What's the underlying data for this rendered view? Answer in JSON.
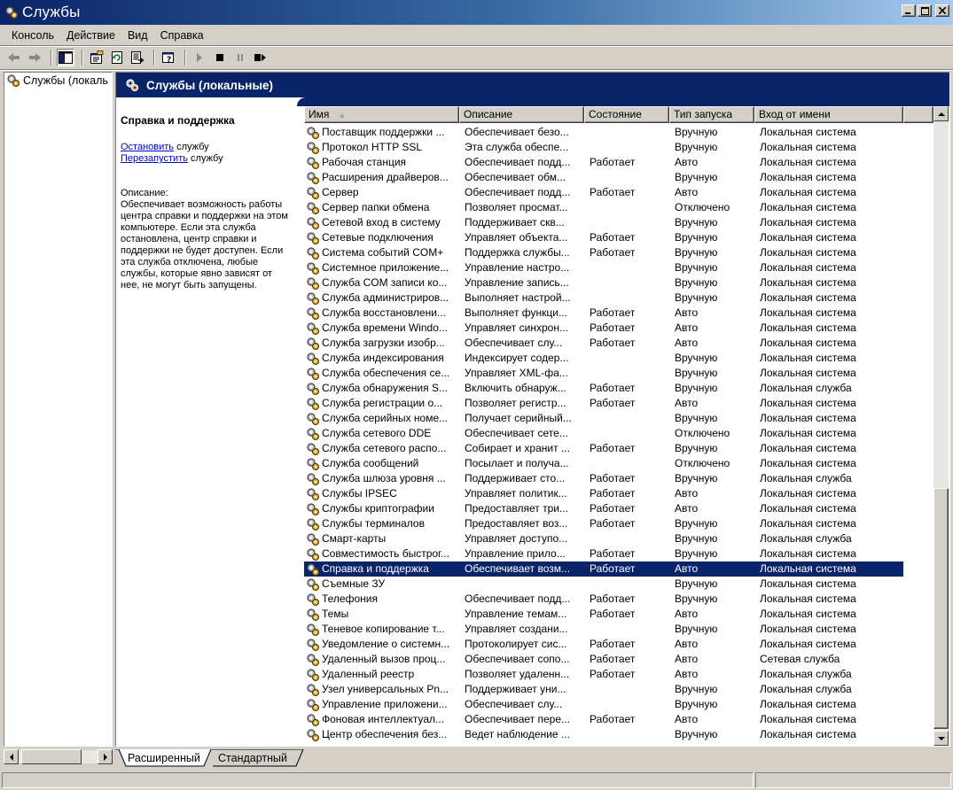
{
  "window": {
    "title": "Службы",
    "buttons": [
      "_",
      "□",
      "×"
    ]
  },
  "menu": [
    "Консоль",
    "Действие",
    "Вид",
    "Справка"
  ],
  "toolbar": {
    "icons": [
      "back-arrow-icon",
      "forward-arrow-icon",
      "show-hide-tree-icon",
      "properties-icon",
      "refresh-icon",
      "export-list-icon",
      "help-icon",
      "start-service-icon",
      "stop-service-icon",
      "pause-service-icon",
      "restart-service-icon"
    ]
  },
  "tree": {
    "items": [
      {
        "label": "Службы (локаль"
      }
    ]
  },
  "pane": {
    "title": "Службы (локальные)",
    "extended": {
      "heading": "Справка и поддержка",
      "actions": [
        {
          "link": "Остановить",
          "rest": " службу"
        },
        {
          "link": "Перезапустить",
          "rest": " службу"
        }
      ],
      "description_label": "Описание:",
      "description": "Обеспечивает возможность работы центра справки и поддержки на этом компьютере. Если эта служба остановлена, центр справки и поддержки не будет доступен. Если эта служба отключена, любые службы, которые явно зависят от нее, не могут быть запущены."
    }
  },
  "list": {
    "columns": [
      "Имя",
      "Описание",
      "Состояние",
      "Тип запуска",
      "Вход от имени"
    ],
    "sort_indicator": "▲",
    "selected_index": 29,
    "rows": [
      [
        "Поставщик поддержки ...",
        "Обеспечивает безо...",
        "",
        "Вручную",
        "Локальная система"
      ],
      [
        "Протокол HTTP SSL",
        "Эта служба обеспе...",
        "",
        "Вручную",
        "Локальная система"
      ],
      [
        "Рабочая станция",
        "Обеспечивает подд...",
        "Работает",
        "Авто",
        "Локальная система"
      ],
      [
        "Расширения драйверов...",
        "Обеспечивает обм...",
        "",
        "Вручную",
        "Локальная система"
      ],
      [
        "Сервер",
        "Обеспечивает подд...",
        "Работает",
        "Авто",
        "Локальная система"
      ],
      [
        "Сервер папки обмена",
        "Позволяет просмат...",
        "",
        "Отключено",
        "Локальная система"
      ],
      [
        "Сетевой вход в систему",
        "Поддерживает скв...",
        "",
        "Вручную",
        "Локальная система"
      ],
      [
        "Сетевые подключения",
        "Управляет объекта...",
        "Работает",
        "Вручную",
        "Локальная система"
      ],
      [
        "Система событий COM+",
        "Поддержка службы...",
        "Работает",
        "Вручную",
        "Локальная система"
      ],
      [
        "Системное приложение...",
        "Управление настро...",
        "",
        "Вручную",
        "Локальная система"
      ],
      [
        "Служба COM записи ко...",
        "Управление запись...",
        "",
        "Вручную",
        "Локальная система"
      ],
      [
        "Служба администриров...",
        "Выполняет настрой...",
        "",
        "Вручную",
        "Локальная система"
      ],
      [
        "Служба восстановлени...",
        "Выполняет функци...",
        "Работает",
        "Авто",
        "Локальная система"
      ],
      [
        "Служба времени Windo...",
        "Управляет синхрон...",
        "Работает",
        "Авто",
        "Локальная система"
      ],
      [
        "Служба загрузки изобр...",
        "Обеспечивает слу...",
        "Работает",
        "Авто",
        "Локальная система"
      ],
      [
        "Служба индексирования",
        "Индексирует содер...",
        "",
        "Вручную",
        "Локальная система"
      ],
      [
        "Служба обеспечения се...",
        "Управляет XML-фа...",
        "",
        "Вручную",
        "Локальная система"
      ],
      [
        "Служба обнаружения S...",
        "Включить обнаруж...",
        "Работает",
        "Вручную",
        "Локальная служба"
      ],
      [
        "Служба регистрации о...",
        "Позволяет регистр...",
        "Работает",
        "Авто",
        "Локальная система"
      ],
      [
        "Служба серийных номе...",
        "Получает серийный...",
        "",
        "Вручную",
        "Локальная система"
      ],
      [
        "Служба сетевого DDE",
        "Обеспечивает сете...",
        "",
        "Отключено",
        "Локальная система"
      ],
      [
        "Служба сетевого распо...",
        "Собирает и хранит ...",
        "Работает",
        "Вручную",
        "Локальная система"
      ],
      [
        "Служба сообщений",
        "Посылает и получа...",
        "",
        "Отключено",
        "Локальная система"
      ],
      [
        "Служба шлюза уровня ...",
        "Поддерживает сто...",
        "Работает",
        "Вручную",
        "Локальная служба"
      ],
      [
        "Службы IPSEC",
        "Управляет политик...",
        "Работает",
        "Авто",
        "Локальная система"
      ],
      [
        "Службы криптографии",
        "Предоставляет три...",
        "Работает",
        "Авто",
        "Локальная система"
      ],
      [
        "Службы терминалов",
        "Предоставляет воз...",
        "Работает",
        "Вручную",
        "Локальная система"
      ],
      [
        "Смарт-карты",
        "Управляет доступо...",
        "",
        "Вручную",
        "Локальная служба"
      ],
      [
        "Совместимость быстрог...",
        "Управление прило...",
        "Работает",
        "Вручную",
        "Локальная система"
      ],
      [
        "Справка и поддержка",
        "Обеспечивает возм...",
        "Работает",
        "Авто",
        "Локальная система"
      ],
      [
        "Съемные ЗУ",
        "",
        "",
        "Вручную",
        "Локальная система"
      ],
      [
        "Телефония",
        "Обеспечивает подд...",
        "Работает",
        "Вручную",
        "Локальная система"
      ],
      [
        "Темы",
        "Управление темам...",
        "Работает",
        "Авто",
        "Локальная система"
      ],
      [
        "Теневое копирование т...",
        "Управляет создани...",
        "",
        "Вручную",
        "Локальная система"
      ],
      [
        "Уведомление о системн...",
        "Протоколирует сис...",
        "Работает",
        "Авто",
        "Локальная система"
      ],
      [
        "Удаленный вызов проц...",
        "Обеспечивает сопо...",
        "Работает",
        "Авто",
        "Сетевая служба"
      ],
      [
        "Удаленный реестр",
        "Позволяет удаленн...",
        "Работает",
        "Авто",
        "Локальная служба"
      ],
      [
        "Узел универсальных Pn...",
        "Поддерживает уни...",
        "",
        "Вручную",
        "Локальная служба"
      ],
      [
        "Управление приложени...",
        "Обеспечивает слу...",
        "",
        "Вручную",
        "Локальная система"
      ],
      [
        "Фоновая интеллектуал...",
        "Обеспечивает пере...",
        "Работает",
        "Авто",
        "Локальная система"
      ],
      [
        "Центр обеспечения без...",
        "Ведет наблюдение ...",
        "",
        "Вручную",
        "Локальная система"
      ]
    ]
  },
  "tabs": [
    {
      "label": "Расширенный",
      "active": true
    },
    {
      "label": "Стандартный",
      "active": false
    }
  ]
}
